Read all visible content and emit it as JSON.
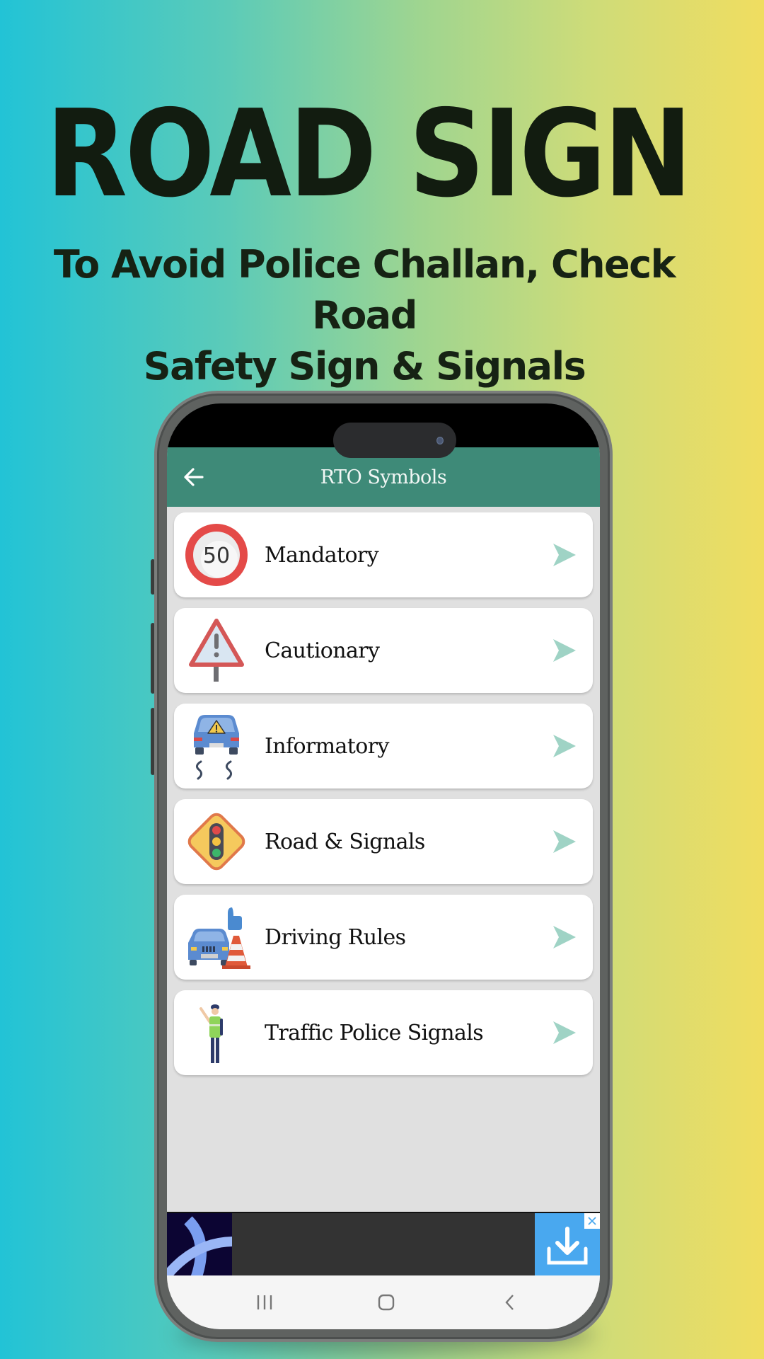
{
  "promo": {
    "headline": "ROAD SIGN",
    "subheadline_line1": "To Avoid Police Challan, Check Road",
    "subheadline_line2": "Safety Sign & Signals"
  },
  "app": {
    "title": "RTO Symbols",
    "back_icon": "arrow-left-icon",
    "colors": {
      "appbar": "#3e8a78",
      "arrow": "#9fd3c5",
      "list_background": "#e0e0e0"
    }
  },
  "categories": [
    {
      "label": "Mandatory",
      "icon": "speed-limit-50-icon",
      "sign_text": "50"
    },
    {
      "label": "Cautionary",
      "icon": "warning-triangle-sign-icon"
    },
    {
      "label": "Informatory",
      "icon": "slippery-car-icon"
    },
    {
      "label": "Road & Signals",
      "icon": "traffic-light-sign-icon"
    },
    {
      "label": "Driving Rules",
      "icon": "car-cone-thumbs-up-icon"
    },
    {
      "label": "Traffic Police Signals",
      "icon": "traffic-police-icon"
    }
  ],
  "ad_banner": {
    "logo_icon": "ad-logo-icon",
    "download_icon": "download-icon",
    "close_icon": "close-icon"
  },
  "system_nav": {
    "recents_icon": "recents-icon",
    "home_icon": "home-icon",
    "back_icon": "back-chevron-icon"
  }
}
